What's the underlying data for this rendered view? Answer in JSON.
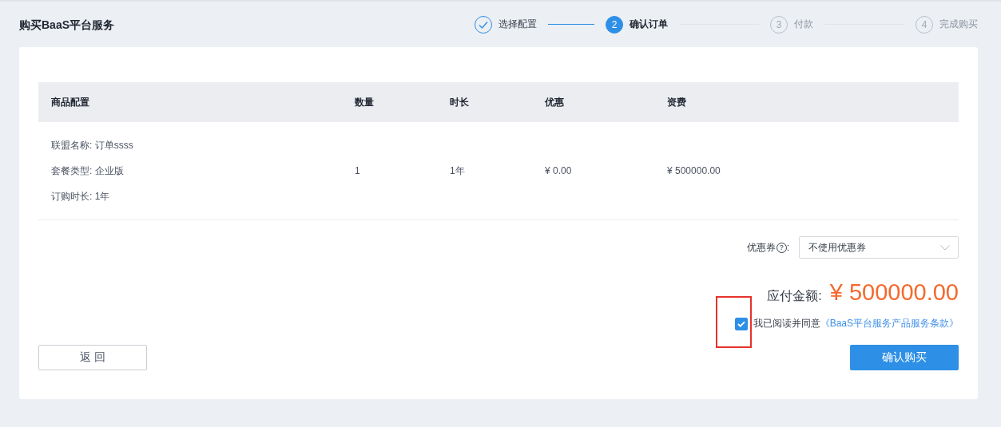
{
  "page_title": "购买BaaS平台服务",
  "steps": [
    {
      "label": "选择配置",
      "completed": true,
      "selected": false
    },
    {
      "number": "2",
      "label": "确认订单",
      "completed": false,
      "selected": true
    },
    {
      "number": "3",
      "label": "付款",
      "completed": false,
      "selected": false
    },
    {
      "number": "4",
      "label": "完成购买",
      "completed": false,
      "selected": false
    }
  ],
  "table": {
    "columns": [
      "商品配置",
      "数量",
      "时长",
      "优惠",
      "资费"
    ],
    "rows": [
      {
        "config": [
          "联盟名称: 订单ssss",
          "套餐类型: 企业版",
          "订购时长: 1年"
        ],
        "quantity": "1",
        "duration": "1年",
        "discount": "¥ 0.00",
        "fee": "¥ 500000.00"
      }
    ]
  },
  "coupon": {
    "label": "优惠券",
    "help_mark": "?",
    "colon": ":",
    "value": "不使用优惠券"
  },
  "total": {
    "label": "应付金额:",
    "amount": "¥ 500000.00"
  },
  "agreement": {
    "checked": true,
    "text": "我已阅读并同意",
    "link": "《BaaS平台服务产品服务条款》"
  },
  "buttons": {
    "back": "返 回",
    "confirm": "确认购买"
  }
}
